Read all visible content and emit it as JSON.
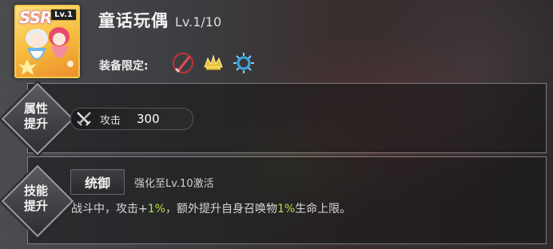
{
  "card": {
    "rarity": "SSR",
    "level_badge": "Lv.1"
  },
  "header": {
    "name": "童话玩偶",
    "level": "Lv.1/10"
  },
  "equipment": {
    "label": "装备限定:",
    "icons": [
      "crimson-blade-icon",
      "golden-crown-icon",
      "blue-sunburst-icon"
    ],
    "colors": {
      "red": "#c0313a",
      "gold": "#e8c43a",
      "blue": "#3aa7e8"
    }
  },
  "attributes": {
    "section_label_line1": "属性",
    "section_label_line2": "提升",
    "stat_name": "攻击",
    "stat_value": "300"
  },
  "skill": {
    "section_label_line1": "技能",
    "section_label_line2": "提升",
    "name": "统御",
    "condition": "强化至Lv.10激活",
    "desc_part1": "战斗中，攻击+",
    "desc_val1": "1%",
    "desc_part2": "，额外提升自身召唤物",
    "desc_val2": "1%",
    "desc_part3": "生命上限。",
    "highlight_color": "#b5e048"
  }
}
